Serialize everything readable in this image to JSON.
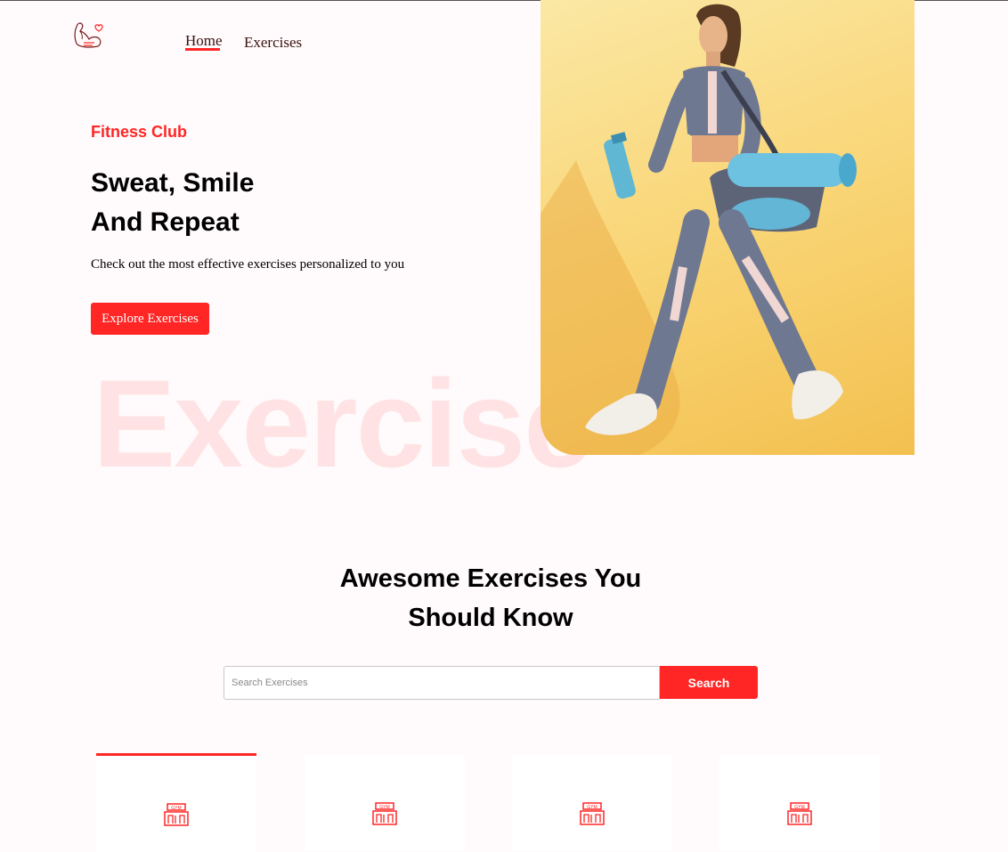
{
  "nav": {
    "logo_icon": "flexed-bicep-heart-icon",
    "items": [
      {
        "label": "Home",
        "active": true
      },
      {
        "label": "Exercises",
        "active": false
      }
    ]
  },
  "hero": {
    "kicker": "Fitness Club",
    "title_line1": "Sweat, Smile",
    "title_line2": "And Repeat",
    "subtitle": "Check out the most effective exercises personalized to you",
    "cta_label": "Explore Exercises",
    "background_word": "Exercise",
    "image": "woman-walking-with-gym-bag-and-water-bottle"
  },
  "search": {
    "heading_line1": "Awesome Exercises You",
    "heading_line2": "Should Know",
    "placeholder": "Search Exercises",
    "value": "",
    "button_label": "Search"
  },
  "categories": [
    {
      "icon": "gym-building-icon",
      "active": true
    },
    {
      "icon": "gym-building-icon",
      "active": false
    },
    {
      "icon": "gym-building-icon",
      "active": false
    },
    {
      "icon": "gym-building-icon",
      "active": false
    }
  ],
  "colors": {
    "accent": "#ff2625",
    "page_background": "#fffafb",
    "hero_image_background": "#f9d576"
  }
}
